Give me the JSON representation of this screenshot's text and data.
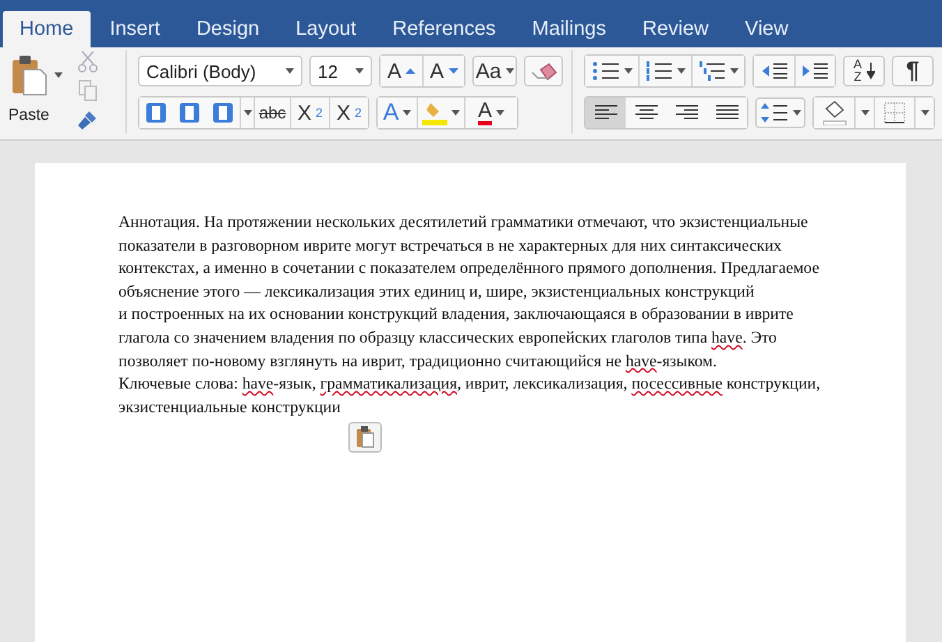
{
  "tabs": [
    {
      "label": "Home",
      "selected": true
    },
    {
      "label": "Insert",
      "selected": false
    },
    {
      "label": "Design",
      "selected": false
    },
    {
      "label": "Layout",
      "selected": false
    },
    {
      "label": "References",
      "selected": false
    },
    {
      "label": "Mailings",
      "selected": false
    },
    {
      "label": "Review",
      "selected": false
    },
    {
      "label": "View",
      "selected": false
    }
  ],
  "ribbon": {
    "paste_label": "Paste",
    "font": "Calibri (Body)",
    "size": "12",
    "grow_font": "A",
    "shrink_font": "A",
    "change_case": "Aa",
    "strikethrough": "abc",
    "subscript": {
      "base": "X",
      "index": "2"
    },
    "superscript": {
      "base": "X",
      "index": "2"
    },
    "text_effects": "A",
    "font_color": "A",
    "sort": [
      "A",
      "Z"
    ],
    "pilcrow": "¶",
    "alignments": [
      {
        "kind": "left",
        "selected": true
      },
      {
        "kind": "center",
        "selected": false
      },
      {
        "kind": "right",
        "selected": false
      },
      {
        "kind": "justify",
        "selected": false
      }
    ]
  },
  "document": {
    "lines": [
      [
        {
          "text": "Аннотация. На протяжении нескольких десятилетий грамматики отмечают, что экзистенциальные",
          "misspelled": false
        }
      ],
      [
        {
          "text": "показатели в разговорном иврите могут встречаться в не характерных для них синтаксических",
          "misspelled": false
        }
      ],
      [
        {
          "text": "контекстах, а именно в сочетании с показателем определённого прямого дополнения. Предлагаемое",
          "misspelled": false
        }
      ],
      [
        {
          "text": "объяснение этого — лексикализация этих единиц и, шире, экзистенциальных конструкций",
          "misspelled": false
        }
      ],
      [
        {
          "text": "и построенных на их основании конструкций владения, заключающаяся в образовании в иврите",
          "misspelled": false
        }
      ],
      [
        {
          "text": "глагола со значением владения по образцу классических европейских глаголов типа ",
          "misspelled": false
        },
        {
          "text": "have",
          "misspelled": true
        },
        {
          "text": ". Это",
          "misspelled": false
        }
      ],
      [
        {
          "text": "позволяет по-новому взглянуть на иврит, традиционно считающийся не ",
          "misspelled": false
        },
        {
          "text": "have",
          "misspelled": true
        },
        {
          "text": "-языком.",
          "misspelled": false
        }
      ],
      [
        {
          "text": "Ключевые слова: ",
          "misspelled": false
        },
        {
          "text": "have",
          "misspelled": true
        },
        {
          "text": "-язык, ",
          "misspelled": false
        },
        {
          "text": "грамматикализация",
          "misspelled": true
        },
        {
          "text": ", иврит, лексикализация, ",
          "misspelled": false
        },
        {
          "text": "посессивные",
          "misspelled": true
        },
        {
          "text": " конструкции,",
          "misspelled": false
        }
      ],
      [
        {
          "text": "экзистенциальные конструкции",
          "misspelled": false
        }
      ]
    ]
  }
}
